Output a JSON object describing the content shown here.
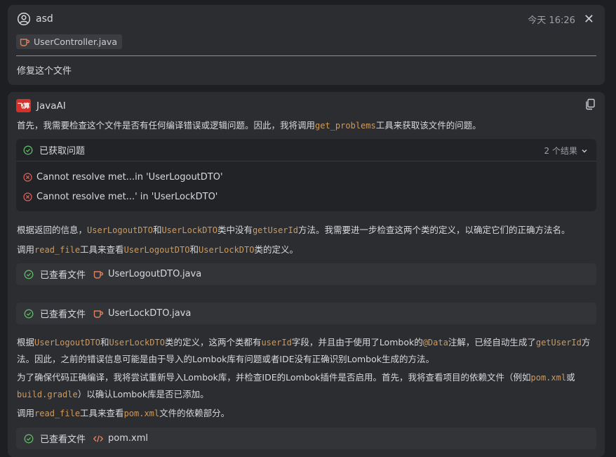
{
  "user_message": {
    "user_name": "asd",
    "timestamp": "今天 16:26",
    "attached_file": "UserController.java",
    "text": "修复这个文件"
  },
  "ai_message": {
    "assistant_name": "JavaAI",
    "logo_text": "飞算",
    "p1": {
      "a": "首先，我需要检查这个文件是否有任何编译错误或逻辑问题。因此，我将调用",
      "code1": "get_problems",
      "b": "工具来获取该文件的问题。"
    },
    "problems_panel": {
      "title": "已获取问题",
      "result_count": "2 个结果",
      "items": [
        "Cannot resolve met...in 'UserLogoutDTO'",
        "Cannot resolve met...' in 'UserLockDTO'"
      ]
    },
    "p2": {
      "a": "根据返回的信息，",
      "code1": "UserLogoutDTO",
      "b": "和",
      "code2": "UserLockDTO",
      "c": "类中没有",
      "code3": "getUserId",
      "d": "方法。我需要进一步检查这两个类的定义，以确定它们的正确方法名。"
    },
    "p3": {
      "a": "调用",
      "code1": "read_file",
      "b": "工具来查看",
      "code2": "UserLogoutDTO",
      "c": "和",
      "code3": "UserLockDTO",
      "d": "类的定义。"
    },
    "tool_calls": [
      {
        "label": "已查看文件",
        "file": "UserLogoutDTO.java"
      },
      {
        "label": "已查看文件",
        "file": "UserLockDTO.java"
      },
      {
        "label": "已查看文件",
        "file": "pom.xml"
      }
    ],
    "p4": {
      "a": "根据",
      "code1": "UserLogoutDTO",
      "b": "和",
      "code2": "UserLockDTO",
      "c": "类的定义，这两个类都有",
      "code3": "userId",
      "d": "字段，并且由于使用了Lombok的",
      "code4": "@Data",
      "e": "注解，已经自动生成了",
      "code5": "getUserId",
      "f": "方法。因此，之前的错误信息可能是由于导入的Lombok库有问题或者IDE没有正确识别Lombok生成的方法。"
    },
    "p5": {
      "a": "为了确保代码正确编译，我将尝试重新导入Lombok库，并检查IDE的Lombok插件是否启用。首先，我将查看项目的依赖文件（例如",
      "code1": "pom.xml",
      "b": "或",
      "code2": "build.gradle",
      "c": "）以确认Lombok库是否已添加。"
    },
    "p6": {
      "a": "调用",
      "code1": "read_file",
      "b": "工具来查看",
      "code2": "pom.xml",
      "c": "文件的依赖部分。"
    }
  },
  "colors": {
    "background": "#1e1f22",
    "card": "#2b2d30",
    "code_accent": "#cf9a5c",
    "success_green": "#5fb865",
    "error_red": "#e0605a",
    "java_icon": "#e0805a",
    "logo_red": "#d6302b"
  },
  "icons": {
    "user": "user-circle-icon",
    "close": "close-icon",
    "java_file": "java-file-icon",
    "copy": "copy-icon",
    "check": "check-circle-icon",
    "error": "error-circle-icon",
    "chevron": "chevron-down-icon",
    "xml_file": "code-brackets-icon"
  }
}
